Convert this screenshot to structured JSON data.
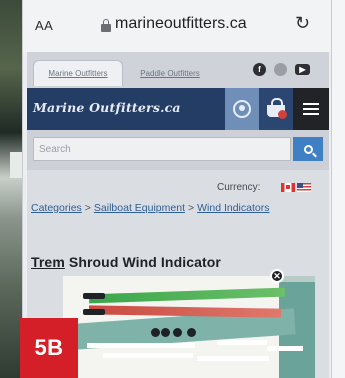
{
  "browser": {
    "text_size_label": "AA",
    "url": "marineoutfitters.ca",
    "reload_icon": "reload-icon"
  },
  "site_tabs": [
    {
      "label": "Marine Outfitters"
    },
    {
      "label": "Paddle Outfitters"
    }
  ],
  "social_icons": [
    "facebook-icon",
    "instagram-icon",
    "youtube-icon"
  ],
  "header": {
    "logo_text": "Marine Outfitters.ca",
    "account_icon": "account-icon",
    "cart_icon": "cart-icon",
    "menu_icon": "hamburger-menu-icon"
  },
  "search": {
    "placeholder": "Search"
  },
  "currency": {
    "label": "Currency:"
  },
  "breadcrumb": {
    "items": [
      "Categories",
      "Sailboat Equipment",
      "Wind Indicators"
    ],
    "separator": ">"
  },
  "product": {
    "brand": "Trem",
    "title_rest": "Shroud Wind Indicator"
  },
  "figure_label": "5B",
  "colors": {
    "header_bg": "#233d64",
    "search_button": "#3f7fc3",
    "label_red": "#d41f28"
  }
}
